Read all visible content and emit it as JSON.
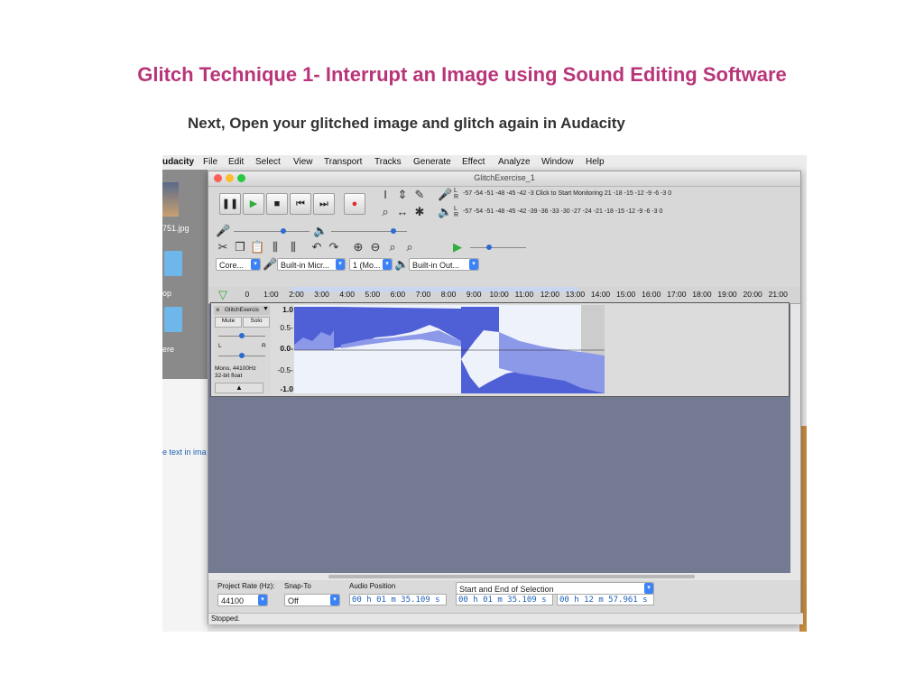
{
  "slide": {
    "title": "Glitch Technique 1- Interrupt an Image using Sound Editing Software",
    "subtitle": "Next, Open your glitched image and glitch again in Audacity"
  },
  "menubar": {
    "app": "udacity",
    "items": [
      "File",
      "Edit",
      "Select",
      "View",
      "Transport",
      "Tracks",
      "Generate",
      "Effect",
      "Analyze",
      "Window",
      "Help"
    ]
  },
  "desktop": {
    "file_label": "751.jpg",
    "folder1_label": "op",
    "folder2_label": "ere",
    "pane_text": "e text in ima"
  },
  "window": {
    "title": "GlitchExercise_1"
  },
  "meters": {
    "channel_l": "L",
    "channel_r": "R",
    "record_scale": "-57 -54 -51 -48 -45 -42 -3",
    "record_hint": "Click to Start Monitoring",
    "record_scale_end": "21 -18 -15 -12 -9 -6 -3 0",
    "play_scale": "-57 -54 -51 -48 -45 -42 -39 -36 -33 -30 -27 -24 -21 -18 -15 -12 -9 -6 -3 0"
  },
  "device": {
    "host": "Core...",
    "input": "Built-in Micr...",
    "channels": "1 (Mo...",
    "output": "Built-in Out..."
  },
  "timeline": {
    "ticks": [
      "0",
      "1:00",
      "2:00",
      "3:00",
      "4:00",
      "5:00",
      "6:00",
      "7:00",
      "8:00",
      "9:00",
      "10:00",
      "11:00",
      "12:00",
      "13:00",
      "14:00",
      "15:00",
      "16:00",
      "17:00",
      "18:00",
      "19:00",
      "20:00",
      "21:00"
    ]
  },
  "track": {
    "name": "GlitchExercis",
    "mute": "Mute",
    "solo": "Solo",
    "pan_l": "L",
    "pan_r": "R",
    "info_line1": "Mono, 44100Hz",
    "info_line2": "32-bit float",
    "ruler": [
      "1.0",
      "0.5-",
      "0.0-",
      "-0.5-",
      "-1.0"
    ]
  },
  "bottom": {
    "project_rate_label": "Project Rate (Hz):",
    "project_rate_value": "44100",
    "snap_label": "Snap-To",
    "snap_value": "Off",
    "audio_position_label": "Audio Position",
    "audio_position_value": "00 h 01 m 35.109 s",
    "selection_mode": "Start and End of Selection",
    "selection_start": "00 h 01 m 35.109 s",
    "selection_end": "00 h 12 m 57.961 s"
  },
  "status": "Stopped.",
  "colors": {
    "accent": "#b8357a",
    "waveform": "#4f5fd6",
    "waveform_light": "#8c98e8",
    "track_bg": "#737a91"
  },
  "icons": {
    "transport": [
      "pause-icon",
      "play-icon",
      "stop-icon",
      "skip-start-icon",
      "skip-end-icon",
      "record-icon"
    ],
    "tools": [
      "select-tool-icon",
      "envelope-tool-icon",
      "draw-tool-icon",
      "zoom-tool-icon",
      "timeshift-tool-icon",
      "multi-tool-icon"
    ]
  }
}
